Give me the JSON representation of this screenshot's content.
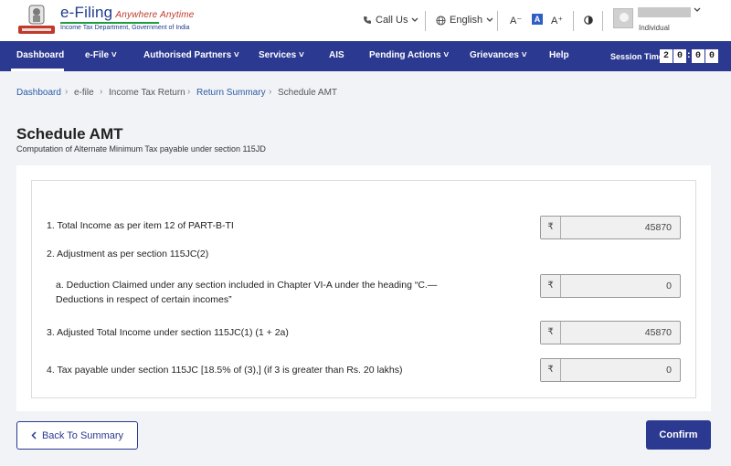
{
  "brand": {
    "title": "e-Filing",
    "tagline": "Anywhere Anytime",
    "subtitle": "Income Tax Department, Government of India"
  },
  "header": {
    "call_us": "Call Us",
    "language": "English",
    "font_decrease": "A⁻",
    "font_default": "A",
    "font_increase": "A⁺",
    "user_role": "Individual"
  },
  "nav": {
    "items": [
      "Dashboard",
      "e-File",
      "Authorised Partners",
      "Services",
      "AIS",
      "Pending Actions",
      "Grievances",
      "Help"
    ],
    "active": "Dashboard",
    "session_label": "Session Time",
    "session_digits": [
      "2",
      "0",
      "0",
      "0"
    ]
  },
  "breadcrumb": [
    "Dashboard",
    "e-file",
    "Income Tax Return",
    "Return Summary",
    "Schedule AMT"
  ],
  "page": {
    "title": "Schedule AMT",
    "subtitle": "Computation of Alternate Minimum Tax payable under section 115JD"
  },
  "form": {
    "currency_symbol": "₹",
    "rows": [
      {
        "label": "1. Total Income as per item 12 of PART-B-TI",
        "value": "45870"
      },
      {
        "label": "2. Adjustment as per section 115JC(2)"
      },
      {
        "label_line1": "a. Deduction Claimed under any section included in Chapter VI-A under the heading “C.—",
        "label_line2": "Deductions in respect of certain incomes”",
        "value": "0"
      },
      {
        "label": "3. Adjusted Total Income under section 115JC(1) (1 + 2a)",
        "value": "45870"
      },
      {
        "label": "4. Tax payable under section 115JC [18.5% of (3),] (if 3 is greater than Rs. 20 lakhs)",
        "value": "0"
      }
    ]
  },
  "buttons": {
    "back": "Back To Summary",
    "confirm": "Confirm"
  },
  "colors": {
    "primary": "#2b3990",
    "link": "#2b5aa6",
    "page_bg": "#f2f3f7"
  }
}
